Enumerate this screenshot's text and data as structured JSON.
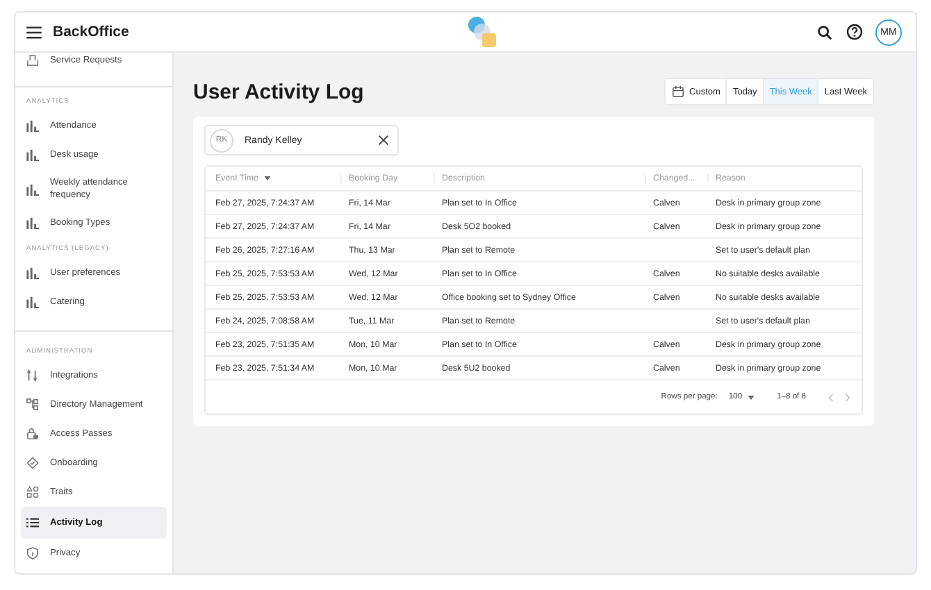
{
  "header": {
    "app_name": "BackOffice",
    "avatar_initials": "MM"
  },
  "sidebar": {
    "sections": [
      {
        "kind": "plain",
        "items": [
          {
            "label": "Service Requests",
            "selected": false
          }
        ]
      },
      {
        "kind": "analytics",
        "heading": "ANALYTICS",
        "items": [
          {
            "label": "Attendance",
            "selected": false
          },
          {
            "label": "Desk usage",
            "selected": false
          },
          {
            "label": "Weekly attendance frequency",
            "selected": false
          },
          {
            "label": "Booking Types",
            "selected": false
          }
        ]
      },
      {
        "kind": "analytics",
        "heading": "ANALYTICS (LEGACY)",
        "items": [
          {
            "label": "User preferences",
            "selected": false
          },
          {
            "label": "Catering",
            "selected": false
          }
        ]
      },
      {
        "kind": "admin",
        "heading": "ADMINISTRATION",
        "items": [
          {
            "label": "Integrations",
            "selected": false
          },
          {
            "label": "Directory Management",
            "selected": false
          },
          {
            "label": "Access Passes",
            "selected": false
          },
          {
            "label": "Onboarding",
            "selected": false
          },
          {
            "label": "Traits",
            "selected": false
          },
          {
            "label": "Activity Log",
            "selected": true
          },
          {
            "label": "Privacy",
            "selected": false
          }
        ]
      }
    ]
  },
  "page": {
    "title": "User Activity Log",
    "ranges": [
      {
        "label": "Custom",
        "kind": "calendar",
        "selected": false
      },
      {
        "label": "Today",
        "kind": "plain",
        "selected": false
      },
      {
        "label": "This Week",
        "kind": "plain",
        "selected": true
      },
      {
        "label": "Last Week",
        "kind": "plain",
        "selected": false
      }
    ],
    "user_filter": {
      "initials": "RK",
      "value": "Randy Kelley"
    },
    "table": {
      "columns": [
        {
          "label": "Event Time",
          "sorted": true
        },
        {
          "label": "Booking Day",
          "sorted": false
        },
        {
          "label": "Description",
          "sorted": false
        },
        {
          "label": "Changed...",
          "sorted": false
        },
        {
          "label": "Reason",
          "sorted": false
        }
      ],
      "rows": [
        [
          "Feb 27, 2025, 7:24:37 AM",
          "Fri, 14 Mar",
          "Plan set to In Office",
          "Calven",
          "Desk in primary group zone"
        ],
        [
          "Feb 27, 2025, 7:24:37 AM",
          "Fri, 14 Mar",
          "Desk 5O2 booked",
          "Calven",
          "Desk in primary group zone"
        ],
        [
          "Feb 26, 2025, 7:27:16 AM",
          "Thu, 13 Mar",
          "Plan set to Remote",
          "",
          "Set to user's default plan"
        ],
        [
          "Feb 25, 2025, 7:53:53 AM",
          "Wed, 12 Mar",
          "Plan set to In Office",
          "Calven",
          "No suitable desks available"
        ],
        [
          "Feb 25, 2025, 7:53:53 AM",
          "Wed, 12 Mar",
          "Office booking set to Sydney Office",
          "Calven",
          "No suitable desks available"
        ],
        [
          "Feb 24, 2025, 7:08:58 AM",
          "Tue, 11 Mar",
          "Plan set to Remote",
          "",
          "Set to user's default plan"
        ],
        [
          "Feb 23, 2025, 7:51:35 AM",
          "Mon, 10 Mar",
          "Plan set to In Office",
          "Calven",
          "Desk in primary group zone"
        ],
        [
          "Feb 23, 2025, 7:51:34 AM",
          "Mon, 10 Mar",
          "Desk 5U2 booked",
          "Calven",
          "Desk in primary group zone"
        ]
      ]
    },
    "pagination": {
      "rows_label": "Rows per page:",
      "rows_value": "100",
      "range": "1–8 of 8"
    }
  }
}
